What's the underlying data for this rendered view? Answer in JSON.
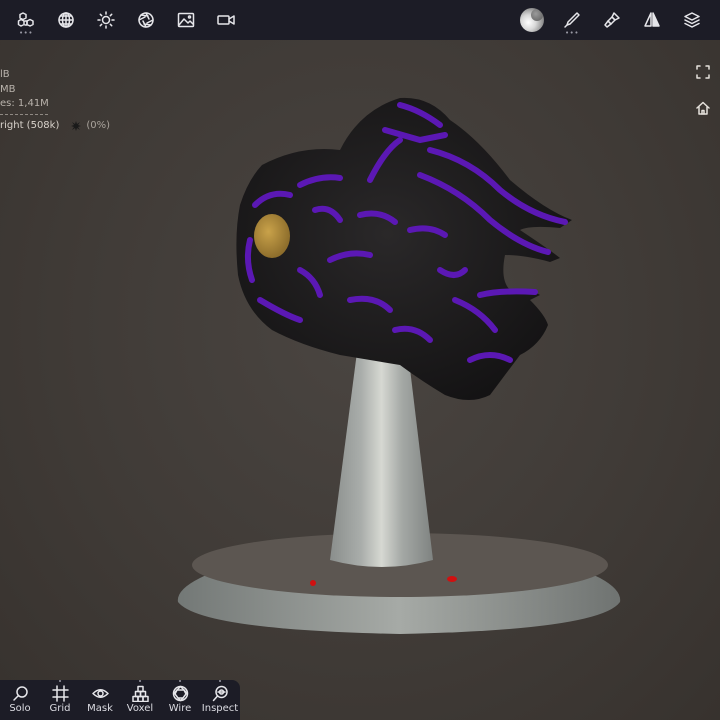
{
  "topbar": {
    "left_tools": [
      {
        "name": "scene-objects",
        "icon": "cubes-icon",
        "has_more": true
      },
      {
        "name": "topology",
        "icon": "sphere-grid-icon",
        "has_more": false
      },
      {
        "name": "lighting",
        "icon": "sun-icon",
        "has_more": false
      },
      {
        "name": "camera",
        "icon": "aperture-icon",
        "has_more": false
      },
      {
        "name": "background",
        "icon": "image-icon",
        "has_more": false
      },
      {
        "name": "video",
        "icon": "video-camera-icon",
        "has_more": false
      }
    ],
    "right_tools": [
      {
        "name": "material",
        "icon": "matcap-sphere-icon",
        "has_more": false
      },
      {
        "name": "brush",
        "icon": "brush-icon",
        "has_more": true
      },
      {
        "name": "paint",
        "icon": "paint-brush-icon",
        "has_more": false
      },
      {
        "name": "symmetry",
        "icon": "symmetry-icon",
        "has_more": false
      },
      {
        "name": "layers",
        "icon": "layers-icon",
        "has_more": false
      }
    ]
  },
  "stats": {
    "lines": [
      "lB",
      "MB",
      "es: 1,41M"
    ],
    "object_name": "right (508k)",
    "object_percent": "(0%)"
  },
  "side": {
    "fullscreen_icon": "fullscreen-icon",
    "home_icon": "home-icon"
  },
  "bottombar": {
    "tools": [
      {
        "label": "Solo",
        "icon": "magnifier-icon"
      },
      {
        "label": "Grid",
        "icon": "grid-frame-icon"
      },
      {
        "label": "Mask",
        "icon": "eye-icon"
      },
      {
        "label": "Voxel",
        "icon": "voxel-cubes-icon"
      },
      {
        "label": "Wire",
        "icon": "wireframe-icon"
      },
      {
        "label": "Inspect",
        "icon": "inspect-icon"
      }
    ]
  },
  "colors": {
    "toolbar_bg": "#1c1c26",
    "viewport_bg": "#403b37",
    "model_dark": "#1e1c1e",
    "model_purple": "#5a1ab0",
    "eye_gold": "#b08a3a",
    "base_grey": "#9ea09c",
    "marker_red": "#d01010"
  }
}
